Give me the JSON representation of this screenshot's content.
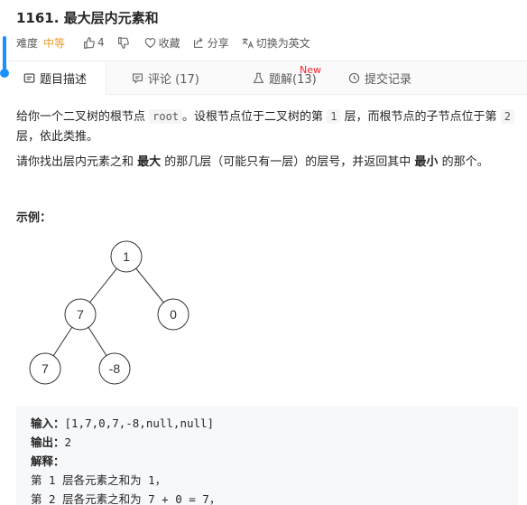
{
  "problem": {
    "title": "1161. 最大层内元素和",
    "difficulty_label": "难度",
    "difficulty": "中等",
    "likes": "4",
    "collect_label": "收藏",
    "share_label": "分享",
    "lang_switch_label": "切换为英文"
  },
  "tabs": [
    {
      "label": "题目描述",
      "icon": "description-icon"
    },
    {
      "label": "评论 (17)",
      "icon": "comment-icon"
    },
    {
      "label": "题解(13)",
      "icon": "flask-icon",
      "badge": "New"
    },
    {
      "label": "提交记录",
      "icon": "clock-icon"
    }
  ],
  "description": {
    "p1_part1": "给你一个二叉树的根节点 ",
    "p1_code1": "root",
    "p1_part2": "。设根节点位于二叉树的第 ",
    "p1_code2": "1",
    "p1_part3": " 层，而根节点的子节点位于第 ",
    "p1_code3": "2",
    "p1_part4": "层，依此类推。",
    "p2_part1": "请你找出层内元素之和 ",
    "p2_bold1": "最大",
    "p2_part2": " 的那几层（可能只有一层）的层号，并返回其中 ",
    "p2_bold2": "最小",
    "p2_part3": " 的那个。",
    "example_label": "示例："
  },
  "tree": {
    "nodes": [
      "1",
      "7",
      "0",
      "7",
      "-8"
    ]
  },
  "example": {
    "input_label": "输入：",
    "input_value": "[1,7,0,7,-8,null,null]",
    "output_label": "输出：",
    "output_value": "2",
    "explain_label": "解释：",
    "line1": "第 1 层各元素之和为 1，",
    "line2": "第 2 层各元素之和为 7 + 0 = 7，"
  },
  "colors": {
    "accent": "#1a90ff",
    "difficulty_medium": "#ef9c2c",
    "new_badge": "#f5222d"
  }
}
